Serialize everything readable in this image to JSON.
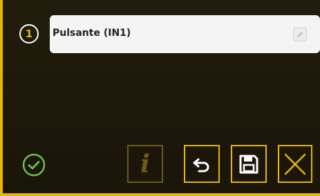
{
  "step": {
    "number": "1"
  },
  "input": {
    "name_value": "Pulsante (IN1)"
  },
  "toolbar": {
    "info_label": "i"
  },
  "colors": {
    "accent": "#e6b800",
    "accent_dim": "#6e5a1a",
    "background": "#1f1a0b",
    "ok_green": "#6cc24a",
    "field_bg": "#f4f4f4"
  },
  "icons": [
    "edit-icon",
    "check-circle-icon",
    "info-icon",
    "undo-icon",
    "save-icon",
    "close-icon"
  ]
}
